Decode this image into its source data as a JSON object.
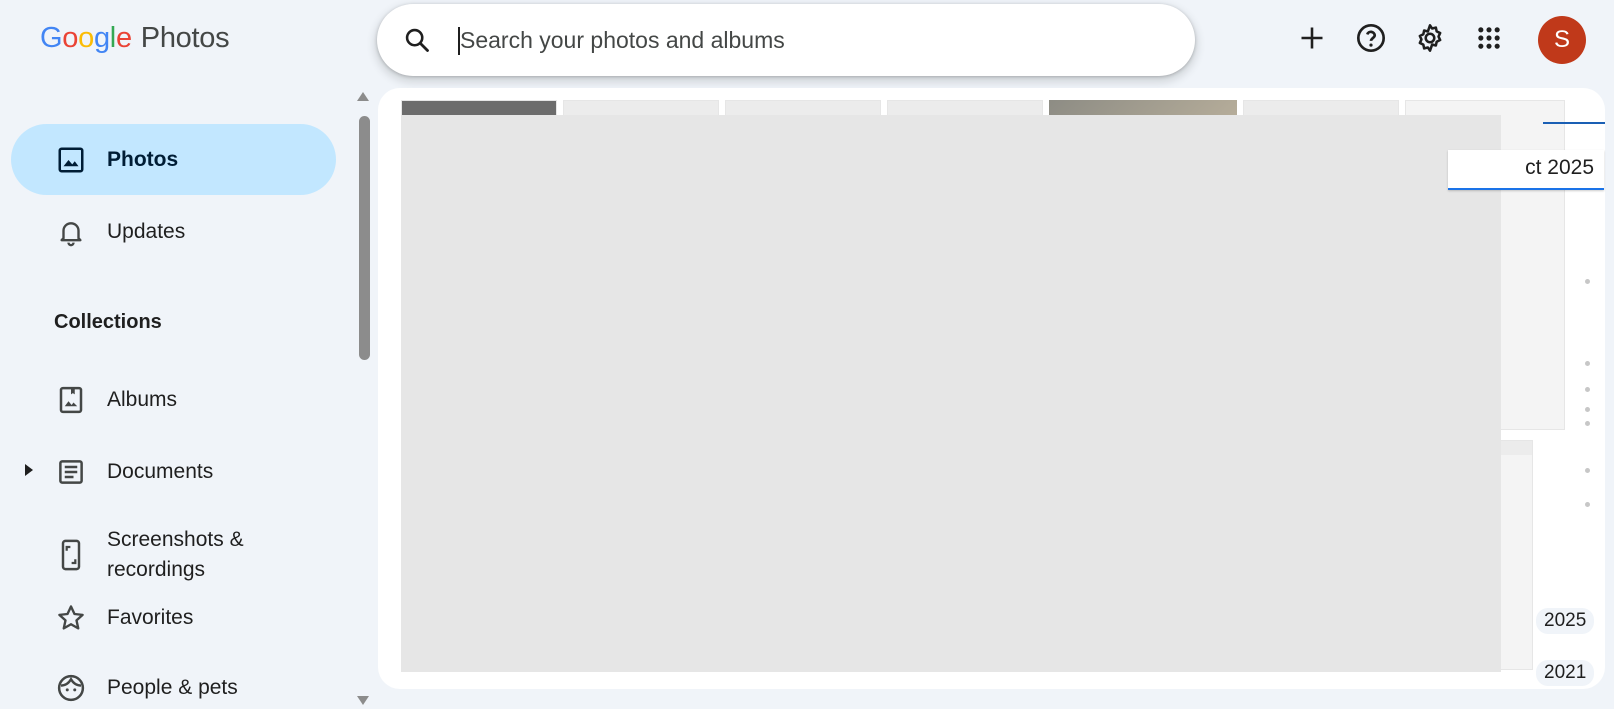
{
  "app": {
    "logo_letters": [
      "G",
      "o",
      "o",
      "g",
      "l",
      "e"
    ],
    "logo_colors": [
      "#4285f4",
      "#ea4335",
      "#fbbc05",
      "#4285f4",
      "#34a853",
      "#ea4335"
    ],
    "product": "Photos"
  },
  "search": {
    "placeholder": "Search your photos and albums"
  },
  "header": {
    "actions": [
      "add-icon",
      "help-icon",
      "settings-icon",
      "apps-icon"
    ],
    "avatar_initial": "S",
    "avatar_color": "#c0391a"
  },
  "sidebar": {
    "items_top": [
      {
        "label": "Photos",
        "icon": "photo-icon",
        "active": true
      },
      {
        "label": "Updates",
        "icon": "bell-icon",
        "active": false
      }
    ],
    "section_title": "Collections",
    "items_collections": [
      {
        "label": "Albums",
        "icon": "album-icon"
      },
      {
        "label": "Documents",
        "icon": "document-icon",
        "expandable": true
      },
      {
        "label": "Screenshots &\nrecordings",
        "icon": "phone-icon"
      },
      {
        "label": "Favorites",
        "icon": "star-icon"
      },
      {
        "label": "People & pets",
        "icon": "face-icon"
      }
    ],
    "active_color": "#c2e7ff"
  },
  "timeline": {
    "current_label": "ct 2025",
    "years": [
      "2025",
      "2021"
    ]
  }
}
